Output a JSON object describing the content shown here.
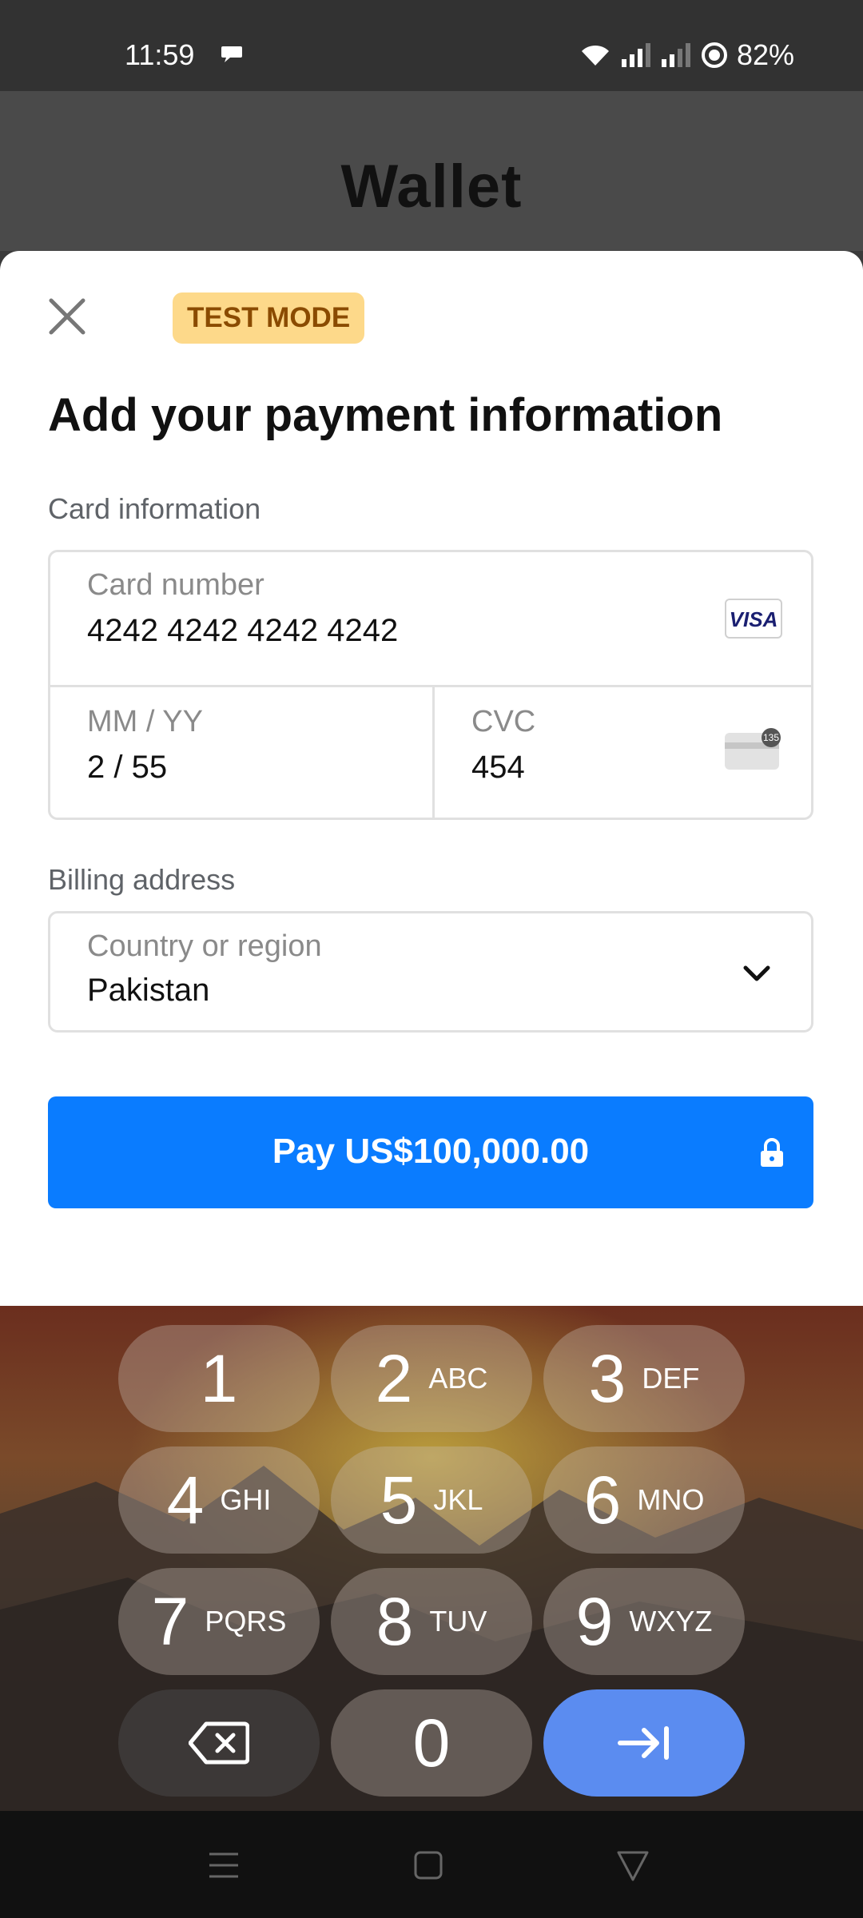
{
  "status": {
    "time": "11:59",
    "battery": "82%"
  },
  "app": {
    "title": "Wallet"
  },
  "sheet": {
    "badge": "TEST MODE",
    "heading": "Add your payment information",
    "card_section_label": "Card information",
    "card_number_label": "Card number",
    "card_number_value": "4242 4242 4242 4242",
    "card_brand": "VISA",
    "expiry_label": "MM / YY",
    "expiry_value": "2 / 55",
    "cvc_label": "CVC",
    "cvc_value": "454",
    "cvc_icon_text": "135",
    "billing_label": "Billing address",
    "country_label": "Country or region",
    "country_value": "Pakistan",
    "pay_label": "Pay US$100,000.00"
  },
  "keypad": [
    {
      "num": "1",
      "letters": ""
    },
    {
      "num": "2",
      "letters": "ABC"
    },
    {
      "num": "3",
      "letters": "DEF"
    },
    {
      "num": "4",
      "letters": "GHI"
    },
    {
      "num": "5",
      "letters": "JKL"
    },
    {
      "num": "6",
      "letters": "MNO"
    },
    {
      "num": "7",
      "letters": "PQRS"
    },
    {
      "num": "8",
      "letters": "TUV"
    },
    {
      "num": "9",
      "letters": "WXYZ"
    },
    {
      "num": "0",
      "letters": ""
    }
  ],
  "colors": {
    "primary": "#0a7cff",
    "badge_bg": "#fdd98a",
    "badge_text": "#8a4b00",
    "enter_key": "#5b8cf0"
  }
}
